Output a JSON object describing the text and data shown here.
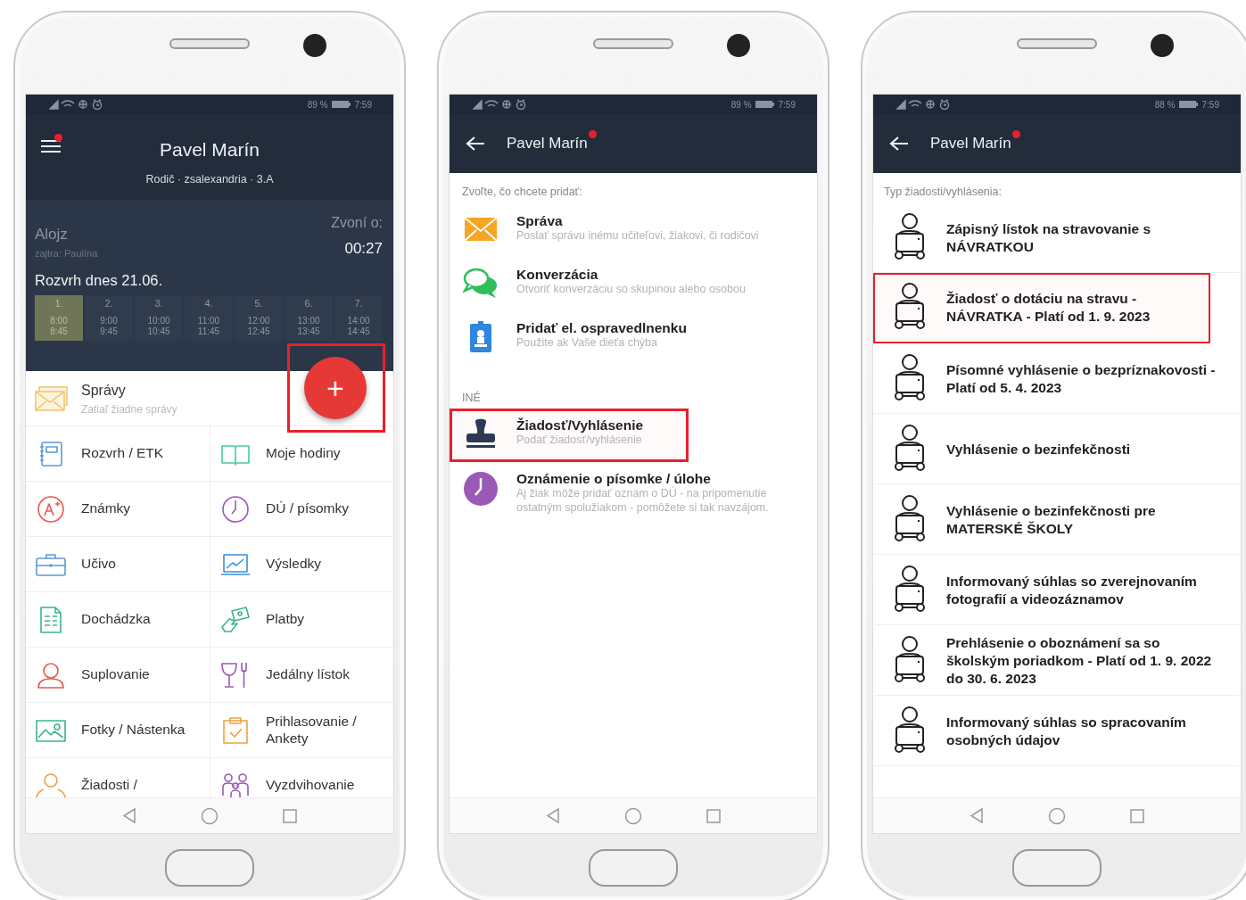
{
  "phones": [
    {
      "kind": "home",
      "status_bar": {
        "battery": "89 %",
        "time": "7:59"
      },
      "header": {
        "title": "Pavel Marín",
        "subtitle": "Rodič · zsalexandria · 3.A",
        "notification": true
      },
      "name_day": {
        "today": "Alojz",
        "tomorrow": "zajtra: Paulína"
      },
      "bell": {
        "label": "Zvoní o:",
        "time": "00:27"
      },
      "schedule": {
        "title": "Rozvrh dnes 21.06.",
        "lessons": [
          {
            "number": "1.",
            "start": "8:00",
            "end": "8:45",
            "selected": true
          },
          {
            "number": "2.",
            "start": "9:00",
            "end": "9:45",
            "selected": false
          },
          {
            "number": "3.",
            "start": "10:00",
            "end": "10:45",
            "selected": false
          },
          {
            "number": "4.",
            "start": "11:00",
            "end": "11:45",
            "selected": false
          },
          {
            "number": "5.",
            "start": "12:00",
            "end": "12:45",
            "selected": false
          },
          {
            "number": "6.",
            "start": "13:00",
            "end": "13:45",
            "selected": false
          },
          {
            "number": "7.",
            "start": "14:00",
            "end": "14:45",
            "selected": false
          }
        ]
      },
      "messages": {
        "title": "Správy",
        "subtitle": "Zatiaľ žiadne správy"
      },
      "fab": {
        "label": "+",
        "highlighted": true
      },
      "menu": [
        {
          "kind": "notebook",
          "label": "Rozvrh / ETK"
        },
        {
          "kind": "book",
          "label": "Moje hodiny"
        },
        {
          "kind": "grade",
          "label": "Známky"
        },
        {
          "kind": "clock",
          "label": "DÚ / písomky"
        },
        {
          "kind": "briefcase",
          "label": "Učivo"
        },
        {
          "kind": "chart",
          "label": "Výsledky"
        },
        {
          "kind": "sheet",
          "label": "Dochádzka"
        },
        {
          "kind": "money",
          "label": "Platby"
        },
        {
          "kind": "person",
          "label": "Suplovanie"
        },
        {
          "kind": "dining",
          "label": "Jedálny lístok"
        },
        {
          "kind": "picture",
          "label": "Fotky / Nástenka"
        },
        {
          "kind": "clipboard",
          "label": "Prihlasovanie / Ankety"
        },
        {
          "kind": "pickup",
          "label": "Žiadosti /"
        },
        {
          "kind": "family",
          "label": "Vyzdvihovanie"
        }
      ]
    },
    {
      "kind": "add",
      "status_bar": {
        "battery": "89 %",
        "time": "7:59"
      },
      "header": {
        "title": "Pavel Marín",
        "notification": true
      },
      "prompt": "Zvoľte, čo chcete pridať:",
      "sections": [
        {
          "items": [
            {
              "kind": "envelope",
              "title": "Správa",
              "description": "Poslať správu inému učiteľovi, žiakovi, či rodičovi",
              "highlighted": false
            },
            {
              "kind": "chat",
              "title": "Konverzácia",
              "description": "Otvoriť konverzáciu so skupinou alebo osobou",
              "highlighted": false
            },
            {
              "kind": "badge",
              "title": "Pridať el. ospravedlnenku",
              "description": "Použite ak Vaše dieťa chýba",
              "highlighted": false
            }
          ]
        },
        {
          "heading": "INÉ",
          "items": [
            {
              "kind": "stamp",
              "title": "Žiadosť/Vyhlásenie",
              "description": "Podať žiadosť/vyhlásenie",
              "highlighted": true
            },
            {
              "kind": "alarm",
              "title": "Oznámenie o písomke / úlohe",
              "description": "Aj žiak môže pridať oznam o DÚ - na pripomenutie ostatným spolužiakom - pomôžete si tak navzájom.",
              "highlighted": false
            }
          ]
        }
      ]
    },
    {
      "kind": "requests",
      "status_bar": {
        "battery": "88 %",
        "time": "7:59"
      },
      "header": {
        "title": "Pavel Marín",
        "notification": true
      },
      "prompt": "Typ žiadosti/vyhlásenia:",
      "items": [
        {
          "label": "Zápisný lístok na stravovanie s NÁVRATKOU",
          "highlighted": false
        },
        {
          "label": "Žiadosť o dotáciu na stravu - NÁVRATKA - Platí od 1. 9. 2023",
          "highlighted": true
        },
        {
          "label": "Písomné vyhlásenie o bezpríznakovosti - Platí od 5. 4. 2023",
          "highlighted": false
        },
        {
          "label": "Vyhlásenie o bezinfekčnosti",
          "highlighted": false
        },
        {
          "label": "Vyhlásenie o bezinfekčnosti pre MATERSKÉ ŠKOLY",
          "highlighted": false
        },
        {
          "label": "Informovaný súhlas so zverejnovaním fotografií a videozáznamov",
          "highlighted": false
        },
        {
          "label": "Prehlásenie o oboznámení sa so školským poriadkom - Platí od 1. 9. 2022 do 30. 6. 2023",
          "highlighted": false
        },
        {
          "label": "Informovaný súhlas so spracovaním osobných údajov",
          "highlighted": false
        }
      ]
    }
  ]
}
